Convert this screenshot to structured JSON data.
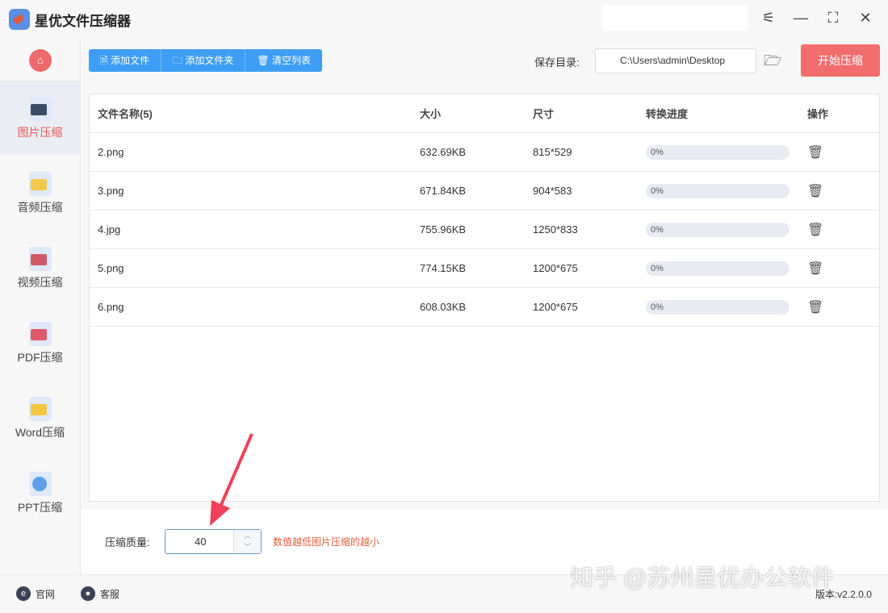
{
  "app": {
    "title": "星优文件压缩器"
  },
  "sidebar": {
    "items": [
      {
        "label": "图片压缩",
        "color": "#3b4b66"
      },
      {
        "label": "音频压缩",
        "color": "#f2c94c"
      },
      {
        "label": "视频压缩",
        "color": "#d05a6a"
      },
      {
        "label": "PDF压缩",
        "color": "#e05a6a"
      },
      {
        "label": "Word压缩",
        "color": "#f5c542"
      },
      {
        "label": "PPT压缩",
        "color": "#5fa0e8"
      }
    ]
  },
  "toolbar": {
    "add_file": "添加文件",
    "add_folder": "添加文件夹",
    "clear_list": "清空列表",
    "save_label": "保存目录:",
    "save_path": "C:\\Users\\admin\\Desktop",
    "start": "开始压缩"
  },
  "table": {
    "headers": [
      "文件名称(5)",
      "大小",
      "尺寸",
      "转换进度",
      "操作"
    ],
    "rows": [
      {
        "name": "2.png",
        "size": "632.69KB",
        "dim": "815*529",
        "progress": "0%"
      },
      {
        "name": "3.png",
        "size": "671.84KB",
        "dim": "904*583",
        "progress": "0%"
      },
      {
        "name": "4.jpg",
        "size": "755.96KB",
        "dim": "1250*833",
        "progress": "0%"
      },
      {
        "name": "5.png",
        "size": "774.15KB",
        "dim": "1200*675",
        "progress": "0%"
      },
      {
        "name": "6.png",
        "size": "608.03KB",
        "dim": "1200*675",
        "progress": "0%"
      }
    ]
  },
  "quality": {
    "label": "压缩质量:",
    "value": "40",
    "hint": "数值越低图片压缩的越小"
  },
  "footer": {
    "website": "官网",
    "support": "客服",
    "version": "版本:v2.2.0.0"
  },
  "watermark": "知乎 @苏州星优办公软件"
}
